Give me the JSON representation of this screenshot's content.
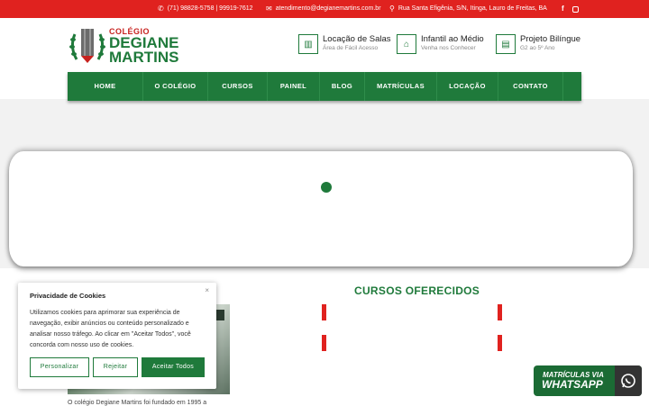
{
  "topbar": {
    "phone": "(71) 98828-5758 | 99919-7612",
    "email": "atendimento@degianemartins.com.br",
    "address": "Rua Santa Efigênia, S/N, Itinga, Lauro de Freitas, BA",
    "phone_icon": "phone-icon",
    "email_icon": "envelope-icon",
    "address_icon": "map-marker-icon",
    "social": [
      "facebook-icon",
      "instagram-icon"
    ]
  },
  "logo": {
    "line0": "COLÉGIO",
    "line1": "DEGIANE",
    "line2": "MARTINS"
  },
  "features": [
    {
      "title": "Locação de Salas",
      "subtitle": "Área de Fácil Acesso",
      "icon": "building-icon"
    },
    {
      "title": "Infantil ao Médio",
      "subtitle": "Venha nos Conhecer",
      "icon": "home-icon"
    },
    {
      "title": "Projeto Bilíngue",
      "subtitle": "G2 ao 5º Ano",
      "icon": "book-icon"
    }
  ],
  "nav": [
    "HOME",
    "O COLÉGIO",
    "CURSOS",
    "PAINEL",
    "BLOG",
    "MATRÍCULAS",
    "LOCAÇÃO",
    "CONTATO"
  ],
  "cursos_title": "CURSOS OFERECIDOS",
  "about_text": "O colégio Degiane Martins foi fundado em 1995 a",
  "cookie": {
    "title": "Privacidade de Cookies",
    "body": "Utilizamos cookies para aprimorar sua experiência de navegação, exibir anúncios ou conteúdo personalizado e analisar nosso tráfego. Ao clicar em \"Aceitar Todos\", você concorda com nosso uso de cookies.",
    "close": "×",
    "btn_customize": "Personalizar",
    "btn_reject": "Rejeitar",
    "btn_accept": "Aceitar Todos"
  },
  "whatsapp": {
    "line1": "MATRÍCULAS VIA",
    "line2": "WHATSAPP",
    "icon": "whatsapp-icon"
  },
  "colors": {
    "red": "#e0221f",
    "green": "#1f7a3b"
  }
}
